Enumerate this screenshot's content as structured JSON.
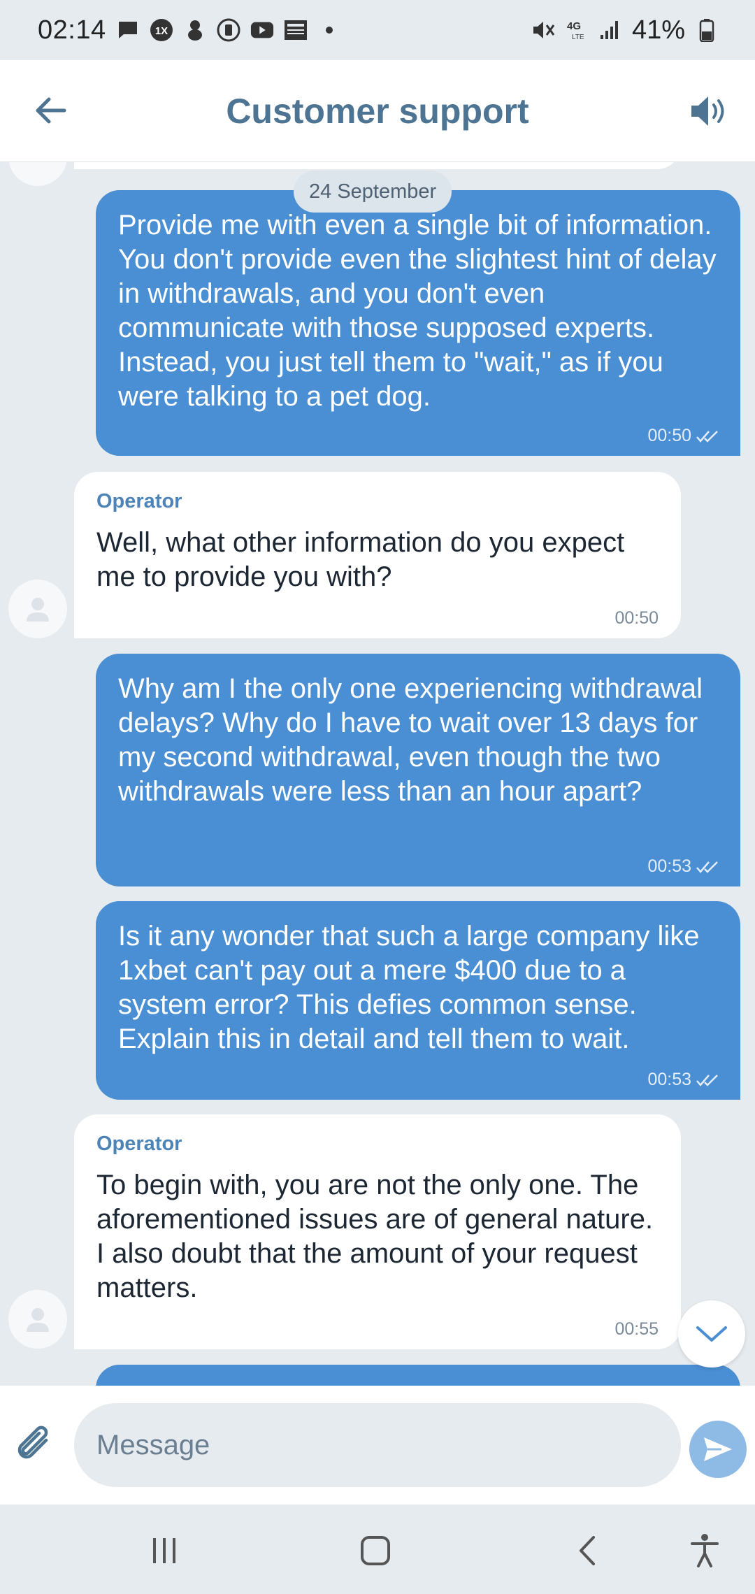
{
  "status_bar": {
    "time": "02:14",
    "battery": "41%",
    "network": "4G LTE",
    "icons_left": [
      "chat-bubble-icon",
      "1xbet-icon",
      "sonic-icon",
      "app-icon",
      "youtube-icon",
      "news-icon",
      "dot-icon"
    ],
    "icons_right": [
      "mute-icon",
      "lte-icon",
      "signal-icon",
      "battery-icon"
    ]
  },
  "header": {
    "title": "Customer support",
    "back_icon": "arrow-left-icon",
    "speaker_icon": "speaker-icon"
  },
  "chat": {
    "date_divider": "24 September",
    "messages": [
      {
        "direction": "out",
        "text": "Provide me with even a single bit of information. You don't provide even the slightest hint of delay in withdrawals, and you don't even communicate with those supposed experts. Instead, you just tell them to \"wait,\" as if you were talking to a pet dog.",
        "time": "00:50",
        "status": "read"
      },
      {
        "direction": "in",
        "sender": "Operator",
        "text": "Well, what other information do you expect me to provide you with?",
        "time": "00:50"
      },
      {
        "direction": "out",
        "text": "Why am I the only one experiencing withdrawal delays? Why do I have to wait over 13 days for my second withdrawal, even though the two withdrawals were less than an hour apart?",
        "time": "00:53",
        "status": "read"
      },
      {
        "direction": "out",
        "text": "Is it any wonder that such a large company like 1xbet can't pay out a mere $400 due to a system error? This defies common sense. Explain this in detail and tell them to wait.",
        "time": "00:53",
        "status": "read"
      },
      {
        "direction": "in",
        "sender": "Operator",
        "text": "To begin with, you are not the only one. The aforementioned issues are of general nature. I also doubt that the amount of your request matters.",
        "time": "00:55"
      }
    ]
  },
  "composer": {
    "placeholder": "Message",
    "attach_icon": "paperclip-icon",
    "send_icon": "send-icon"
  },
  "nav_bar": {
    "icons": [
      "recents-icon",
      "home-icon",
      "back-icon",
      "accessibility-icon"
    ]
  },
  "colors": {
    "outgoing_bubble": "#4a8ed3",
    "incoming_bubble": "#ffffff",
    "background": "#e6ebf0",
    "title": "#4d7593",
    "sender": "#4d84b7"
  }
}
